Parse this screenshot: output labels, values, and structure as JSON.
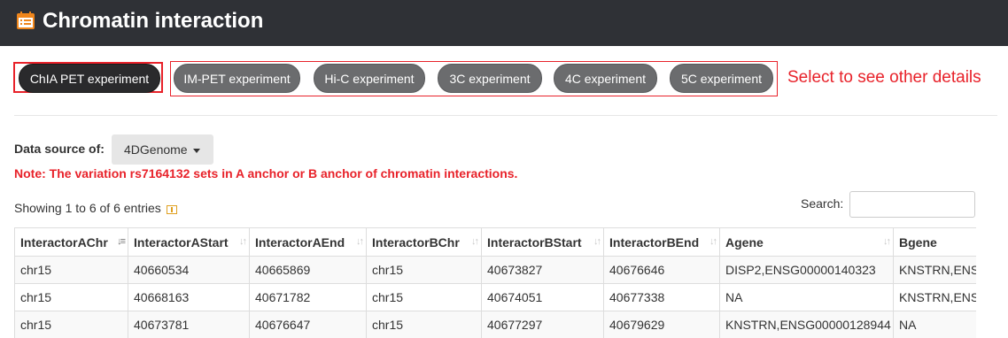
{
  "header": {
    "title": "Chromatin interaction",
    "icon": "calendar-list-icon"
  },
  "experiments": {
    "buttons": [
      {
        "label": "ChIA PET experiment",
        "active": true
      },
      {
        "label": "IM-PET experiment",
        "active": false
      },
      {
        "label": "Hi-C experiment",
        "active": false
      },
      {
        "label": "3C experiment",
        "active": false
      },
      {
        "label": "4C experiment",
        "active": false
      },
      {
        "label": "5C experiment",
        "active": false
      }
    ],
    "callout": "Select to see other details"
  },
  "data_source": {
    "label": "Data source of:",
    "value": "4DGenome"
  },
  "note": "Note: The variation rs7164132 sets in A anchor or B anchor of chromatin interactions.",
  "table_info": {
    "showing": "Showing 1 to 6 of 6 entries",
    "search_label": "Search:"
  },
  "table": {
    "columns": [
      "InteractorAChr",
      "InteractorAStart",
      "InteractorAEnd",
      "InteractorBChr",
      "InteractorBStart",
      "InteractorBEnd",
      "Agene",
      "Bgene"
    ],
    "rows": [
      [
        "chr15",
        "40660534",
        "40665869",
        "chr15",
        "40673827",
        "40676646",
        "DISP2,ENSG00000140323",
        "KNSTRN,ENS"
      ],
      [
        "chr15",
        "40668163",
        "40671782",
        "chr15",
        "40674051",
        "40677338",
        "NA",
        "KNSTRN,ENS"
      ],
      [
        "chr15",
        "40673781",
        "40676647",
        "chr15",
        "40677297",
        "40679629",
        "KNSTRN,ENSG00000128944",
        "NA"
      ]
    ]
  },
  "colors": {
    "header_bg": "#2f3136",
    "accent_red": "#e8222a",
    "button_gray": "#6b6c6e",
    "button_active": "#2a2a2c",
    "icon_orange": "#f0861c"
  }
}
